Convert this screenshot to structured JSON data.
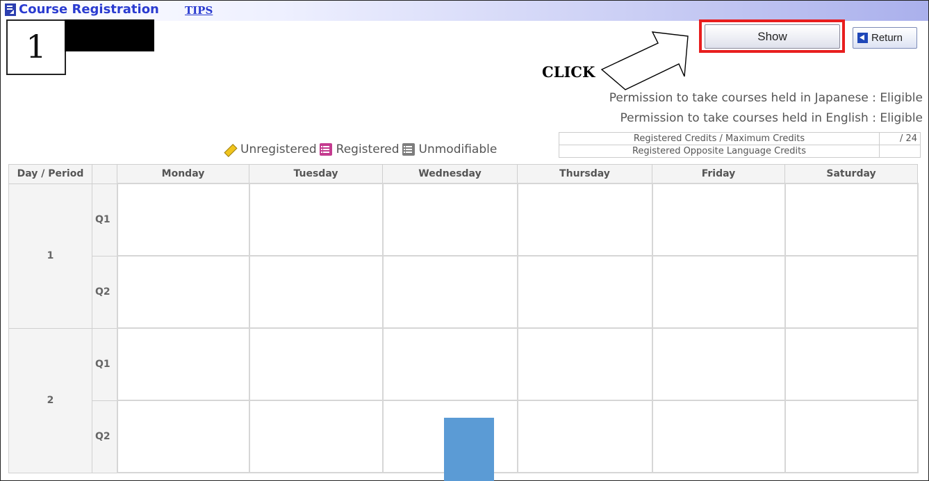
{
  "header": {
    "title": "Course Registration",
    "tips_link": "TIPS"
  },
  "annotation": {
    "step_number": "1",
    "click_label": "CLICK"
  },
  "toolbar": {
    "show_label": "Show",
    "return_label": "Return"
  },
  "permissions": {
    "japanese": "Permission to take courses held in Japanese : Eligible",
    "english": "Permission to take courses held in English : Eligible"
  },
  "credits": {
    "rows": [
      {
        "label": "Registered Credits / Maximum Credits",
        "value": "/ 24"
      },
      {
        "label": "Registered Opposite Language Credits",
        "value": ""
      }
    ]
  },
  "legend": {
    "unregistered": "Unregistered",
    "registered": "Registered",
    "unmodifiable": "Unmodifiable"
  },
  "timetable": {
    "corner_header": "Day / Period",
    "days": [
      "Monday",
      "Tuesday",
      "Wednesday",
      "Thursday",
      "Friday",
      "Saturday"
    ],
    "periods": [
      {
        "label": "1",
        "quarters": [
          "Q1",
          "Q2"
        ]
      },
      {
        "label": "2",
        "quarters": [
          "Q1",
          "Q2"
        ]
      }
    ]
  },
  "colors": {
    "title_blue": "#2a3bd0",
    "highlight_red": "#e81e1e",
    "marker_blue": "#5b9bd5",
    "registered_icon": "#c43b8f"
  },
  "icons": [
    "course-icon",
    "return-icon",
    "pencil-icon",
    "registered-icon",
    "unmodifiable-icon",
    "arrow-callout-icon"
  ]
}
